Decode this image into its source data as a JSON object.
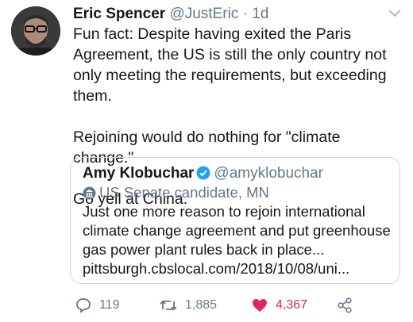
{
  "tweet": {
    "author_name": "Eric Spencer",
    "author_handle": "@JustEric",
    "separator": "·",
    "age": "1d",
    "paragraphs": [
      "Fun fact: Despite having exited the Paris Agreement, the US is still the only country not only meeting the requirements, but exceeding them.",
      "Rejoining would do nothing for \"climate change.\"",
      "Go yell at China."
    ]
  },
  "quoted": {
    "author_name": "Amy Klobuchar",
    "author_handle": "@amyklobuchar",
    "label": "US Senate candidate, MN",
    "text": "Just one more reason to rejoin international climate change agreement and put greenhouse gas power plant rules back in place... pittsburgh.cbslocal.com/2018/10/08/uni..."
  },
  "actions": {
    "replies": "119",
    "retweets": "1,885",
    "likes": "4,367"
  },
  "colors": {
    "verified": "#1da1f2",
    "like": "#e0245e",
    "secondary": "#657786"
  }
}
